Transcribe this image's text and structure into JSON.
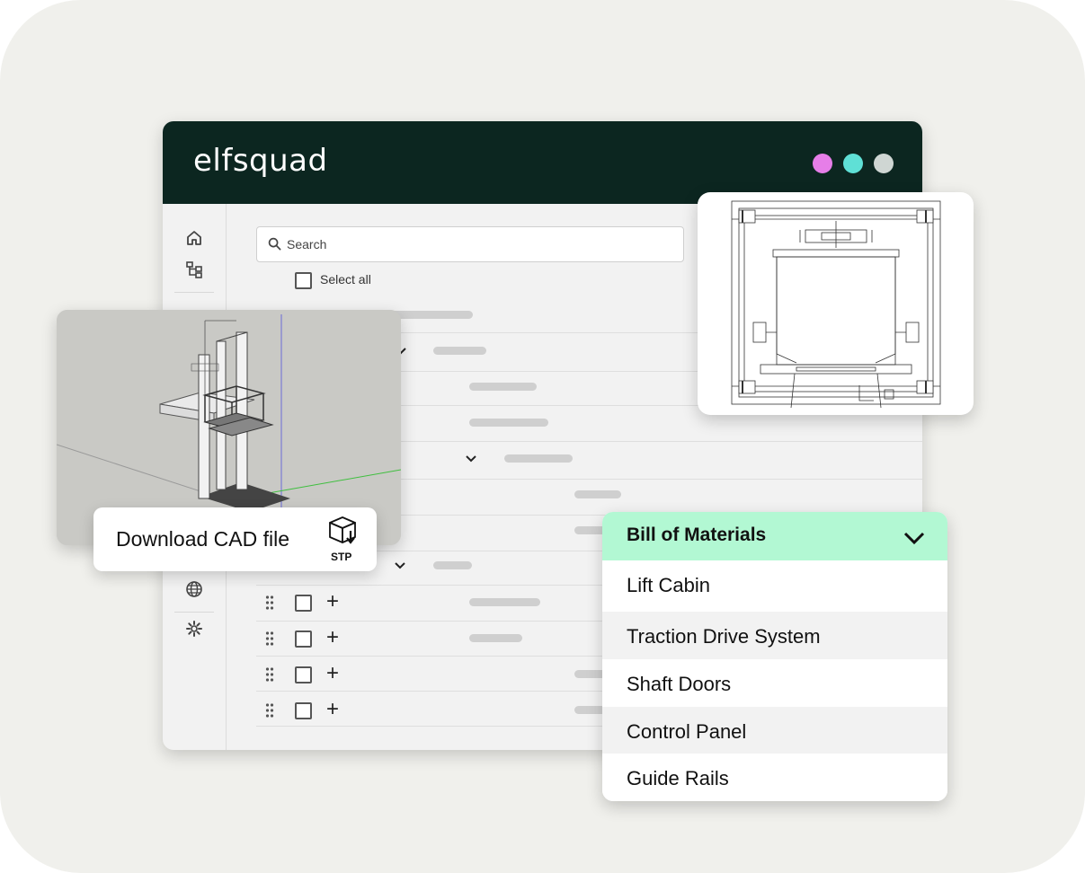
{
  "header": {
    "logo": "elfsquad",
    "dots": [
      "#e67ee8",
      "#5fe0d6",
      "#cfd6d3"
    ]
  },
  "search": {
    "placeholder": "Search",
    "icon": "search-icon"
  },
  "list": {
    "select_all_label": "Select all"
  },
  "sidebar": {
    "icons": [
      "home-icon",
      "hierarchy-icon",
      "globe-icon",
      "gear-icon"
    ]
  },
  "cad": {
    "download_label": "Download CAD file",
    "format": "STP",
    "icon": "cube-download-icon"
  },
  "bom": {
    "title": "Bill of Materials",
    "items": [
      "Lift Cabin",
      "Traction Drive System",
      "Shaft Doors",
      "Control Panel",
      "Guide Rails"
    ]
  }
}
